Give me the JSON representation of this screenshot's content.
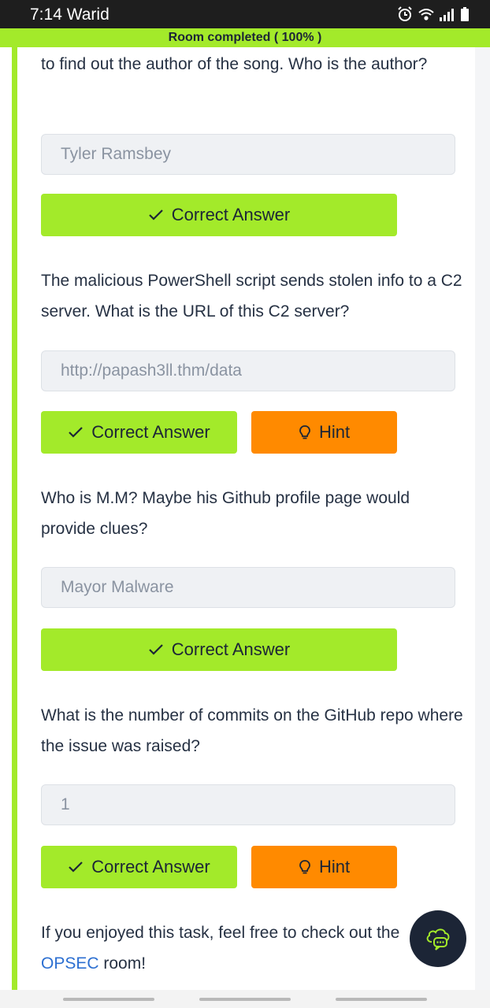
{
  "status_bar": {
    "time_carrier": "7:14 Warid",
    "icons": [
      "alarm-icon",
      "wifi-icon",
      "signal-icon",
      "battery-icon"
    ]
  },
  "banner": {
    "text": "Room completed ( 100% )"
  },
  "questions": [
    {
      "text": "to find out the author of the song. Who is the author?",
      "answer": "Tyler Ramsbey",
      "correct_label": "Correct Answer",
      "has_hint": false
    },
    {
      "text": "The malicious PowerShell script sends stolen info to a C2 server. What is the URL of this C2 server?",
      "answer": "http://papash3ll.thm/data",
      "correct_label": "Correct Answer",
      "hint_label": "Hint",
      "has_hint": true
    },
    {
      "text": "Who is M.M? Maybe his Github profile page would provide clues?",
      "answer": "Mayor Malware",
      "correct_label": "Correct Answer",
      "has_hint": false
    },
    {
      "text": "What is the number of commits on the GitHub repo where the issue was raised?",
      "answer": "1",
      "correct_label": "Correct Answer",
      "hint_label": "Hint",
      "has_hint": true
    }
  ],
  "footer": {
    "text_before": "If you enjoyed this task, feel free to check out the ",
    "link": "OPSEC",
    "text_after": " room!"
  },
  "colors": {
    "accent_green": "#a3ea2a",
    "hint_orange": "#ff8a00",
    "link_blue": "#2c6fd1",
    "text_dark": "#263143"
  }
}
